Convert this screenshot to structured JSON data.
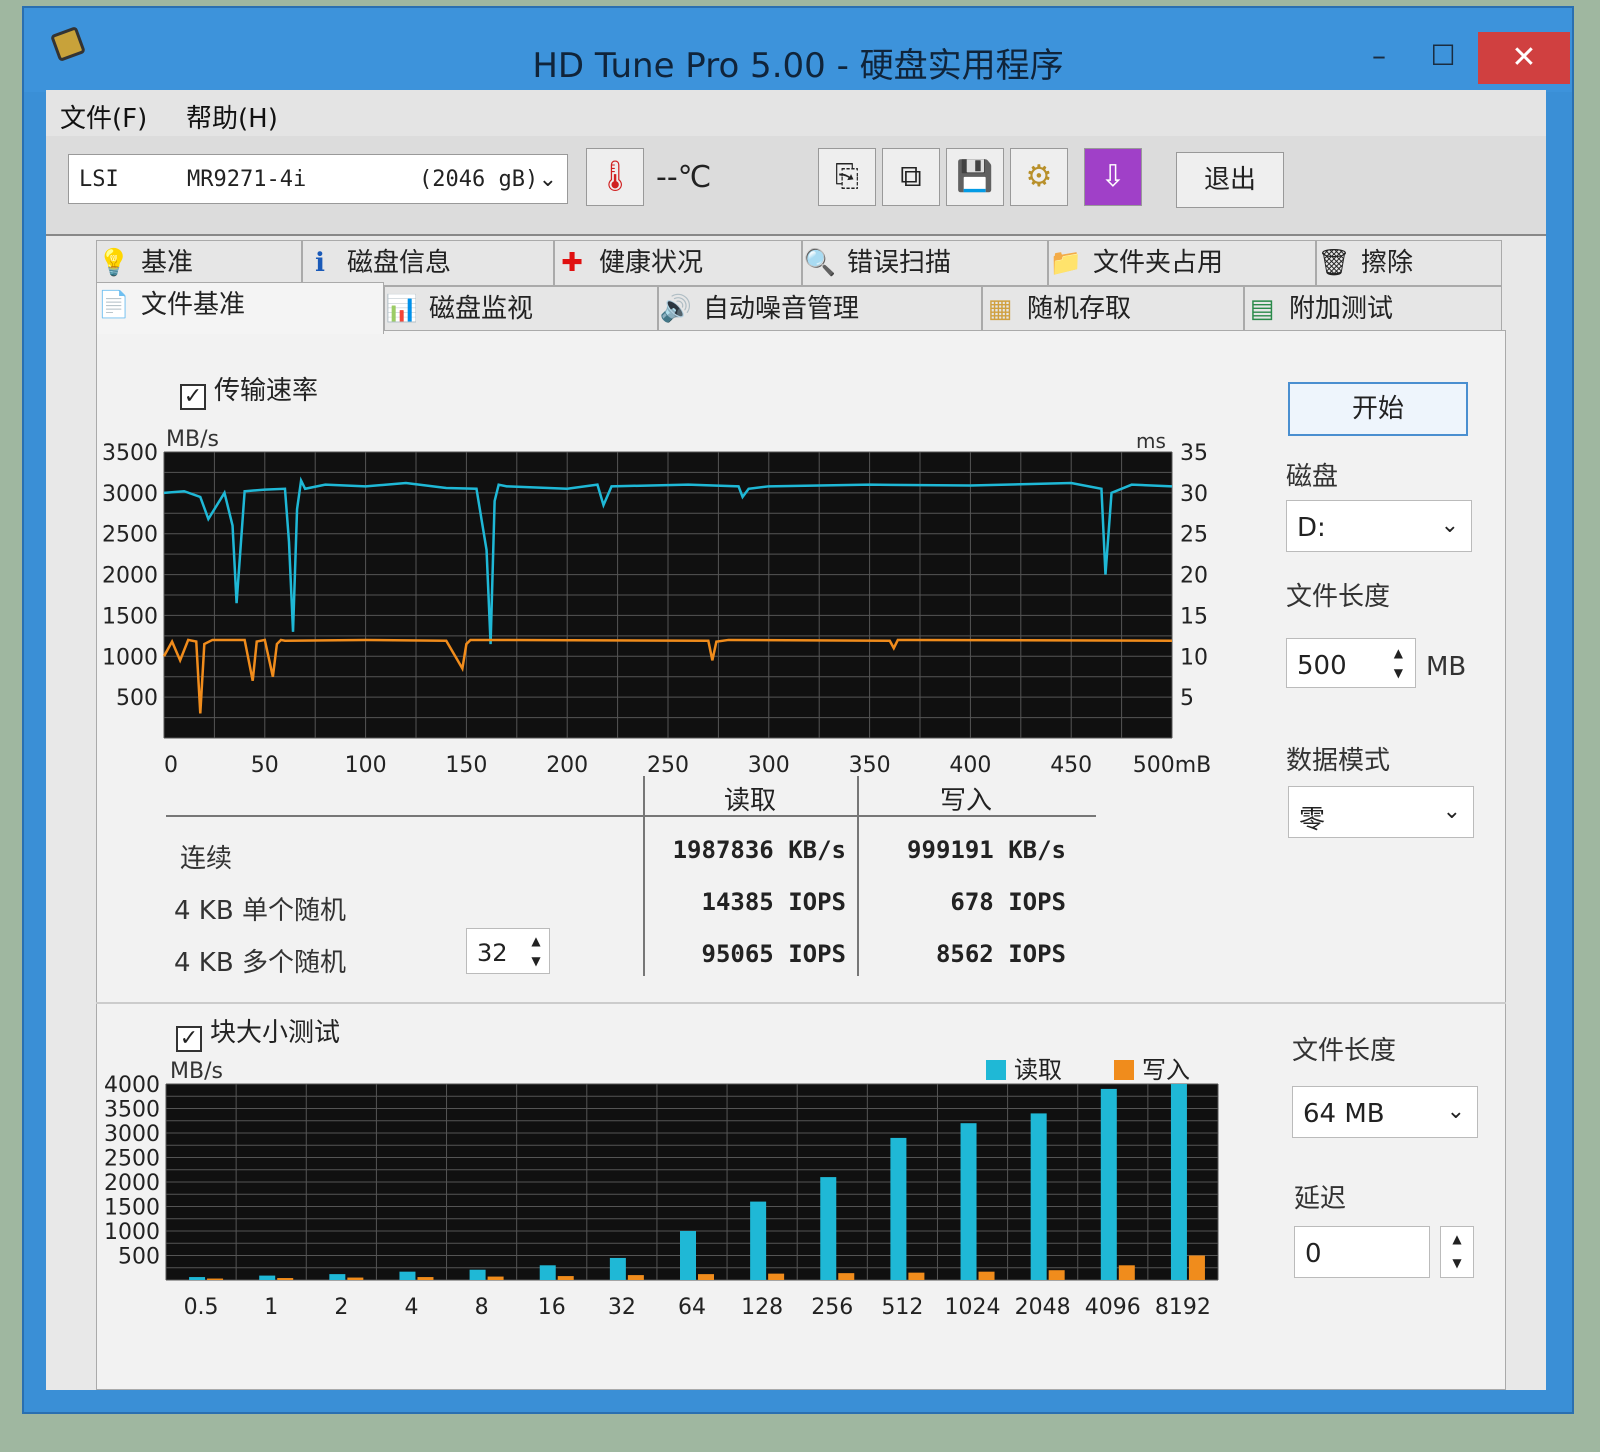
{
  "window": {
    "title": "HD Tune Pro 5.00 - 硬盘实用程序",
    "min": "–",
    "max": "☐",
    "close": "✕"
  },
  "menu": {
    "file": "文件(F)",
    "help": "帮助(H)"
  },
  "toolbar": {
    "drive_name": "LSI",
    "drive_model": "MR9271-4i",
    "drive_size": "(2046 gB)",
    "temperature": "--℃",
    "exit": "退出",
    "icons": [
      "copy-text-icon",
      "copy-screenshot-icon",
      "save-icon",
      "options-icon",
      "download-icon"
    ]
  },
  "tabs_row1": [
    {
      "label": "基准",
      "icon": "bulb-icon"
    },
    {
      "label": "磁盘信息",
      "icon": "info-icon"
    },
    {
      "label": "健康状况",
      "icon": "health-cross-icon"
    },
    {
      "label": "错误扫描",
      "icon": "magnifier-icon"
    },
    {
      "label": "文件夹占用",
      "icon": "folder-icon"
    },
    {
      "label": "擦除",
      "icon": "trash-icon"
    }
  ],
  "tabs_row2": [
    {
      "label": "文件基准",
      "icon": "file-benchmark-icon",
      "active": true
    },
    {
      "label": "磁盘监视",
      "icon": "monitor-chart-icon"
    },
    {
      "label": "自动噪音管理",
      "icon": "speaker-icon"
    },
    {
      "label": "随机存取",
      "icon": "random-access-icon"
    },
    {
      "label": "附加测试",
      "icon": "extra-tests-icon"
    }
  ],
  "transfer": {
    "checkbox_label": "传输速率",
    "checked": true
  },
  "block": {
    "checkbox_label": "块大小测试",
    "checked": true
  },
  "results": {
    "read_header": "读取",
    "write_header": "写入",
    "rows": [
      {
        "label": "连续",
        "read": "1987836 KB/s",
        "write": "999191 KB/s"
      },
      {
        "label": "4 KB 单个随机",
        "read": "14385 IOPS",
        "write": "678 IOPS"
      },
      {
        "label": "4 KB 多个随机",
        "read": "95065 IOPS",
        "write": "8562 IOPS"
      }
    ],
    "queue_depth": "32"
  },
  "side": {
    "start": "开始",
    "disk_label": "磁盘",
    "disk_value": "D:",
    "file_length_label": "文件长度",
    "file_length_value": "500",
    "file_length_unit": "MB",
    "data_mode_label": "数据模式",
    "data_mode_value": "零",
    "block_file_length_label": "文件长度",
    "block_file_length_value": "64 MB",
    "delay_label": "延迟",
    "delay_value": "0"
  },
  "colors": {
    "read": "#1fb8d6",
    "write": "#f08c1c",
    "chart_bg": "#101010",
    "grid": "#555555"
  },
  "chart_data": [
    {
      "type": "line",
      "ylabel": "MB/s",
      "y2label": "ms",
      "xunit": "mB",
      "xlim": [
        0,
        500
      ],
      "ylim": [
        0,
        3500
      ],
      "y2lim": [
        0,
        35
      ],
      "x_ticks": [
        "0",
        "50",
        "100",
        "150",
        "200",
        "250",
        "300",
        "350",
        "400",
        "450",
        "500mB"
      ],
      "y_ticks": [
        "3500",
        "3000",
        "2500",
        "2000",
        "1500",
        "1000",
        "500"
      ],
      "y2_ticks": [
        "35",
        "30",
        "25",
        "20",
        "15",
        "10",
        "5"
      ],
      "grid": true,
      "series": [
        {
          "name": "读取",
          "color": "#1fb8d6",
          "x": [
            0,
            10,
            18,
            22,
            30,
            34,
            36,
            40,
            50,
            60,
            62,
            64,
            66,
            68,
            70,
            80,
            100,
            120,
            140,
            155,
            160,
            162,
            164,
            166,
            170,
            200,
            215,
            218,
            222,
            260,
            285,
            287,
            290,
            300,
            350,
            400,
            450,
            465,
            467,
            470,
            480,
            500
          ],
          "y": [
            3000,
            3020,
            2950,
            2680,
            3000,
            2600,
            1650,
            3020,
            3040,
            3050,
            2400,
            1300,
            2800,
            3150,
            3050,
            3100,
            3080,
            3120,
            3060,
            3050,
            2300,
            1150,
            2900,
            3100,
            3080,
            3050,
            3100,
            2850,
            3080,
            3100,
            3080,
            2950,
            3050,
            3080,
            3100,
            3090,
            3120,
            3050,
            2000,
            3000,
            3100,
            3080
          ]
        },
        {
          "name": "写入",
          "color": "#f08c1c",
          "x": [
            0,
            4,
            8,
            12,
            16,
            18,
            20,
            24,
            40,
            44,
            46,
            50,
            54,
            56,
            58,
            60,
            100,
            140,
            148,
            150,
            152,
            160,
            270,
            272,
            274,
            280,
            360,
            362,
            364,
            370,
            500
          ],
          "y": [
            1000,
            1180,
            950,
            1200,
            1180,
            300,
            1150,
            1200,
            1200,
            700,
            1180,
            1200,
            750,
            1150,
            1200,
            1190,
            1200,
            1190,
            850,
            1150,
            1200,
            1200,
            1190,
            950,
            1180,
            1200,
            1190,
            1100,
            1200,
            1200,
            1190
          ]
        }
      ]
    },
    {
      "type": "bar",
      "ylabel": "MB/s",
      "categories": [
        "0.5",
        "1",
        "2",
        "4",
        "8",
        "16",
        "32",
        "64",
        "128",
        "256",
        "512",
        "1024",
        "2048",
        "4096",
        "8192"
      ],
      "ylim": [
        0,
        4000
      ],
      "y_ticks": [
        "4000",
        "3500",
        "3000",
        "2500",
        "2000",
        "1500",
        "1000",
        "500"
      ],
      "legend": "top-right",
      "grid": true,
      "series": [
        {
          "name": "读取",
          "color": "#1fb8d6",
          "values": [
            60,
            90,
            120,
            170,
            210,
            300,
            450,
            1000,
            1600,
            2100,
            2900,
            3200,
            3400,
            3900,
            4000
          ]
        },
        {
          "name": "写入",
          "color": "#f08c1c",
          "values": [
            30,
            40,
            50,
            60,
            70,
            80,
            100,
            120,
            130,
            140,
            150,
            170,
            200,
            300,
            500
          ]
        }
      ]
    }
  ]
}
